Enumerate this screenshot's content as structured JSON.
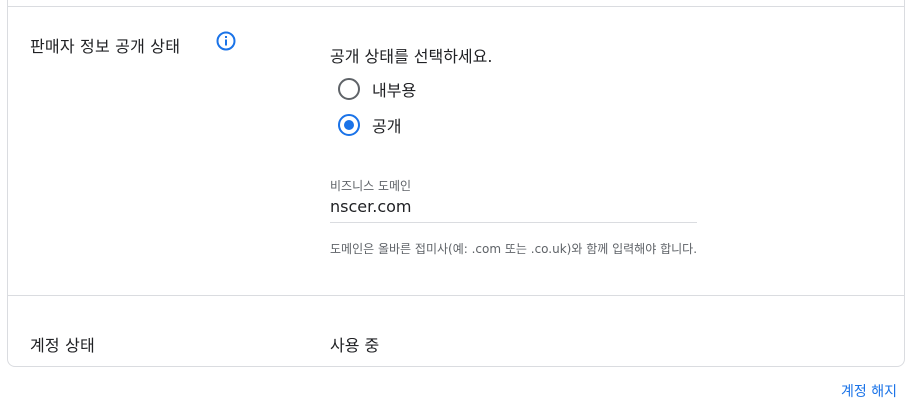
{
  "seller_info": {
    "label": "판매자 정보 공개 상태",
    "info_icon": "info-icon",
    "prompt": "공개 상태를 선택하세요.",
    "options": [
      {
        "label": "내부용",
        "selected": false
      },
      {
        "label": "공개",
        "selected": true
      }
    ]
  },
  "business_domain": {
    "label": "비즈니스 도메인",
    "value": "nscer.com",
    "helper": "도메인은 올바른 접미사(예: .com 또는 .co.uk)와 함께 입력해야 합니다."
  },
  "account_status": {
    "label": "계정 상태",
    "value": "사용 중"
  },
  "footer": {
    "cancel_label": "계정 해지"
  },
  "colors": {
    "accent": "#1a73e8",
    "border": "#dadce0",
    "text": "#202124",
    "secondary_text": "#5f6368"
  }
}
